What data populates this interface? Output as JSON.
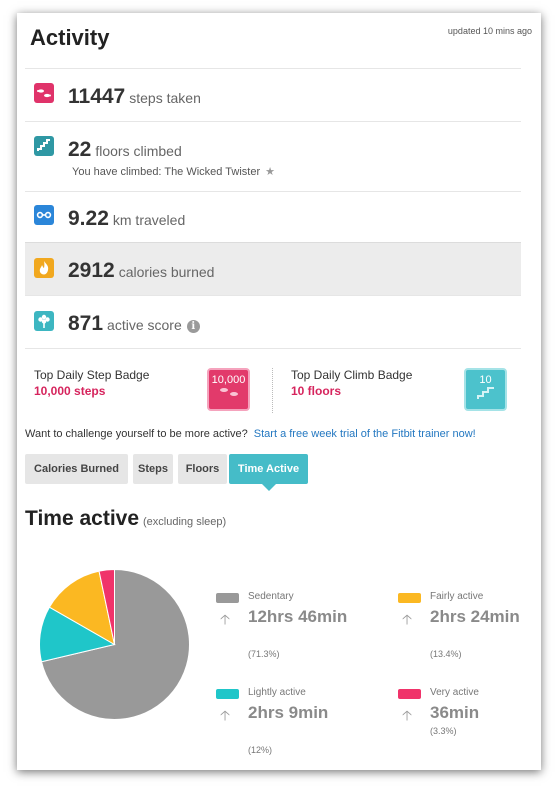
{
  "header": {
    "title": "Activity",
    "updated": "updated 10 mins ago"
  },
  "stats": {
    "steps": {
      "value": "11447",
      "label": "steps taken",
      "icon": "steps-icon",
      "color": "#e0336a"
    },
    "floors": {
      "value": "22",
      "label": "floors climbed",
      "sub": "You have climbed: The Wicked Twister",
      "icon": "stairs-icon",
      "color": "#2f98a4"
    },
    "distance": {
      "value": "9.22",
      "label": "km traveled",
      "icon": "distance-icon",
      "color": "#2b86d9"
    },
    "calories": {
      "value": "2912",
      "label": "calories burned",
      "icon": "flame-icon",
      "color": "#f1a81f"
    },
    "active_score": {
      "value": "871",
      "label": "active score",
      "icon": "flower-icon",
      "color": "#3db6c1"
    }
  },
  "badges": {
    "step": {
      "title": "Top Daily Step Badge",
      "value": "10,000 steps",
      "badge_text": "10,000",
      "color": "#e23a6b"
    },
    "climb": {
      "title": "Top Daily Climb Badge",
      "value": "10 floors",
      "badge_text": "10",
      "color": "#4cc2cc"
    }
  },
  "challenge": {
    "text": "Want to challenge yourself to be more active?",
    "link": "Start a free week trial of the Fitbit trainer now!"
  },
  "tabs": [
    "Calories Burned",
    "Steps",
    "Floors",
    "Time Active"
  ],
  "active_tab": "Time Active",
  "time_active": {
    "title": "Time active",
    "subtitle": "(excluding sleep)"
  },
  "chart_data": {
    "type": "pie",
    "labels": [
      "Sedentary",
      "Lightly active",
      "Fairly active",
      "Very active"
    ],
    "values": [
      71.3,
      12,
      13.4,
      3.3
    ],
    "colors": [
      "#999999",
      "#1fc6c9",
      "#fbb822",
      "#f0336a"
    ],
    "durations": [
      "12hrs 46min",
      "2hrs 9min",
      "2hrs 24min",
      "36min"
    ],
    "percent_labels": [
      "(71.3%)",
      "(12%)",
      "(13.4%)",
      "(3.3%)"
    ]
  }
}
